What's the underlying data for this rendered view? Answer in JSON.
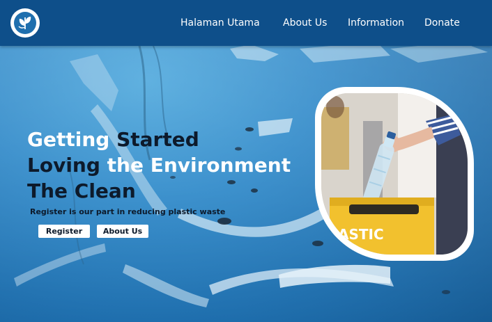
{
  "nav": {
    "items": [
      {
        "label": "Halaman Utama"
      },
      {
        "label": "About Us"
      },
      {
        "label": "Information"
      },
      {
        "label": "Donate"
      }
    ]
  },
  "hero": {
    "line1_a": "Getting ",
    "line1_b": "Started",
    "line2_a": "Loving ",
    "line2_b": "the Environment",
    "line3_a": "The ",
    "line3_b": "Clean",
    "subtitle": "Register is our part in reducing plastic waste",
    "register_label": "Register",
    "about_label": "About Us"
  },
  "photo": {
    "bin_label": "ASTIC"
  },
  "colors": {
    "header": "#0e4f8a",
    "accent_dark": "#0d1a2b",
    "bin_yellow": "#f2c12e"
  }
}
